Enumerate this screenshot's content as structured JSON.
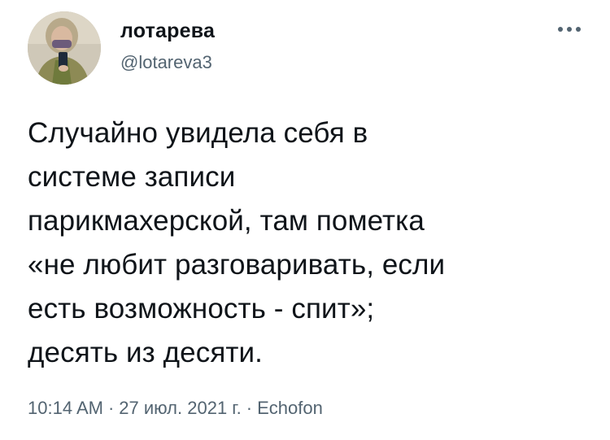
{
  "author": {
    "display_name": "лотарева",
    "handle": "@lotareva3"
  },
  "more_icon": "more-horizontal-icon",
  "tweet": {
    "text": "Случайно увидела себя в\nсистеме записи\nпарикмахерской, там пометка\n«не любит разговаривать, если\nесть возможность - спит»;\nдесять из десяти."
  },
  "meta": {
    "time": "10:14 AM",
    "separator": "·",
    "date": "27 июл. 2021 г.",
    "source": "Echofon"
  },
  "colors": {
    "text": "#0f1419",
    "secondary": "#536471",
    "background": "#ffffff"
  }
}
